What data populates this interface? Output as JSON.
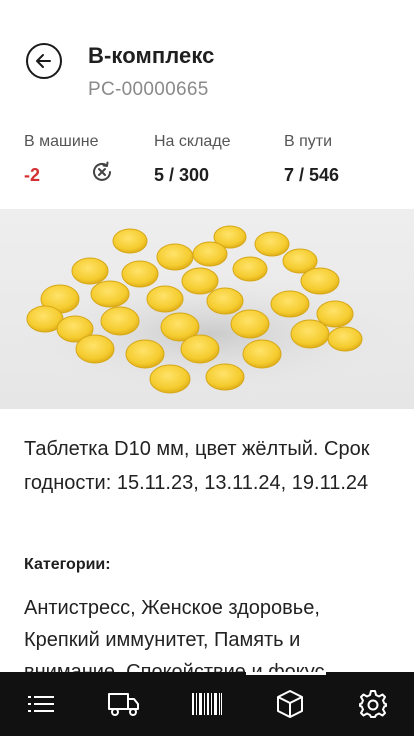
{
  "header": {
    "title": "B-комплекс",
    "code": "PC-00000665"
  },
  "stats": [
    {
      "label": "В машине",
      "value": "-2"
    },
    {
      "label": "На складе",
      "value": "5 / 300"
    },
    {
      "label": "В пути",
      "value": "7 / 546"
    }
  ],
  "colors": {
    "negative": "#d32f2f",
    "nav_background": "#111111",
    "pill_yellow": "#f7d23e"
  },
  "product": {
    "image_icon": "yellow-pills-photo",
    "description": "Таблетка D10 мм, цвет жёлтый. Срок годности: 15.11.23, 13.11.24, 19.11.24",
    "categories_label": "Категории:",
    "categories": "Антистресс, Женское здоровье, Крепкий иммунитет, Память и внимание, Спокойствие и фокус"
  },
  "nav": {
    "items": [
      {
        "icon": "list-icon"
      },
      {
        "icon": "truck-icon"
      },
      {
        "icon": "barcode-icon"
      },
      {
        "icon": "box-icon"
      },
      {
        "icon": "gear-icon"
      }
    ],
    "active_index": 3
  }
}
